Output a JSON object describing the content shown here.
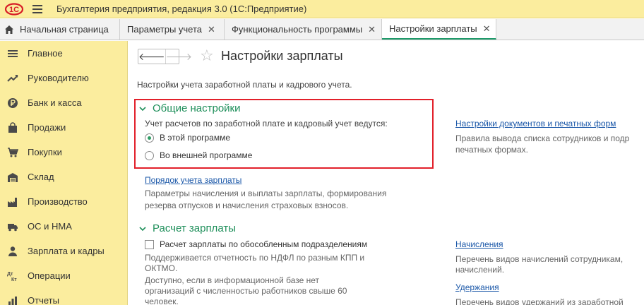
{
  "app": {
    "logo_text": "1С",
    "title": "Бухгалтерия предприятия, редакция 3.0   (1С:Предприятие)"
  },
  "tabs": [
    {
      "label": "Начальная страница"
    },
    {
      "label": "Параметры учета"
    },
    {
      "label": "Функциональность программы"
    },
    {
      "label": "Настройки зарплаты"
    }
  ],
  "tab_close_glyph": "✕",
  "sidebar": {
    "items": [
      {
        "label": "Главное",
        "icon": "hamburger-icon"
      },
      {
        "label": "Руководителю",
        "icon": "trend-icon"
      },
      {
        "label": "Банк и касса",
        "icon": "ruble-icon"
      },
      {
        "label": "Продажи",
        "icon": "bag-icon"
      },
      {
        "label": "Покупки",
        "icon": "cart-icon"
      },
      {
        "label": "Склад",
        "icon": "warehouse-icon"
      },
      {
        "label": "Производство",
        "icon": "factory-icon"
      },
      {
        "label": "ОС и НМА",
        "icon": "truck-icon"
      },
      {
        "label": "Зарплата и кадры",
        "icon": "person-icon"
      },
      {
        "label": "Операции",
        "icon": "dt-kt-icon"
      },
      {
        "label": "Отчеты",
        "icon": "report-icon"
      }
    ],
    "dt": "Дт",
    "kt": "Кт"
  },
  "nav": {
    "back": "🡐",
    "forward": "🡒"
  },
  "page": {
    "star": "☆",
    "title": "Настройки зарплаты",
    "subtitle": "Настройки учета заработной платы и кадрового учета."
  },
  "general": {
    "title": "Общие настройки",
    "question": "Учет расчетов по заработной плате и кадровый учет ведутся:",
    "options": [
      {
        "label": "В этой программе",
        "selected": true
      },
      {
        "label": "Во внешней программе",
        "selected": false
      }
    ],
    "order_link": "Порядок учета зарплаты",
    "order_desc_1": "Параметры начисления и выплаты зарплаты, формирования",
    "order_desc_2": "резерва отпусков и начисления страховых взносов."
  },
  "right_top": {
    "link": "Настройки документов и печатных форм",
    "desc_1": "Правила вывода списка сотрудников и подр",
    "desc_2": "печатных формах."
  },
  "payroll": {
    "title": "Расчет зарплаты",
    "checkbox_label": "Расчет зарплаты по обособленным подразделениям",
    "checked": false,
    "desc_1": "Поддерживается отчетность по НДФЛ по разным КПП и",
    "desc_2": "ОКТМО.",
    "desc_3": "Доступно, если в информационной базе нет",
    "desc_4": "организаций с численностью работников свыше 60",
    "desc_5": "человек."
  },
  "right_bottom": {
    "accruals_link": "Начисления",
    "accruals_desc_1": "Перечень видов начислений сотрудникам,",
    "accruals_desc_2": "начислений.",
    "deductions_link": "Удержания",
    "deductions_desc_1": "Перечень видов удержаний из заработной"
  },
  "colors": {
    "accent_green": "#1e8f5a",
    "link_blue": "#1a57a8",
    "panel_yellow": "#fbed9e",
    "highlight_red": "#e2202a"
  }
}
